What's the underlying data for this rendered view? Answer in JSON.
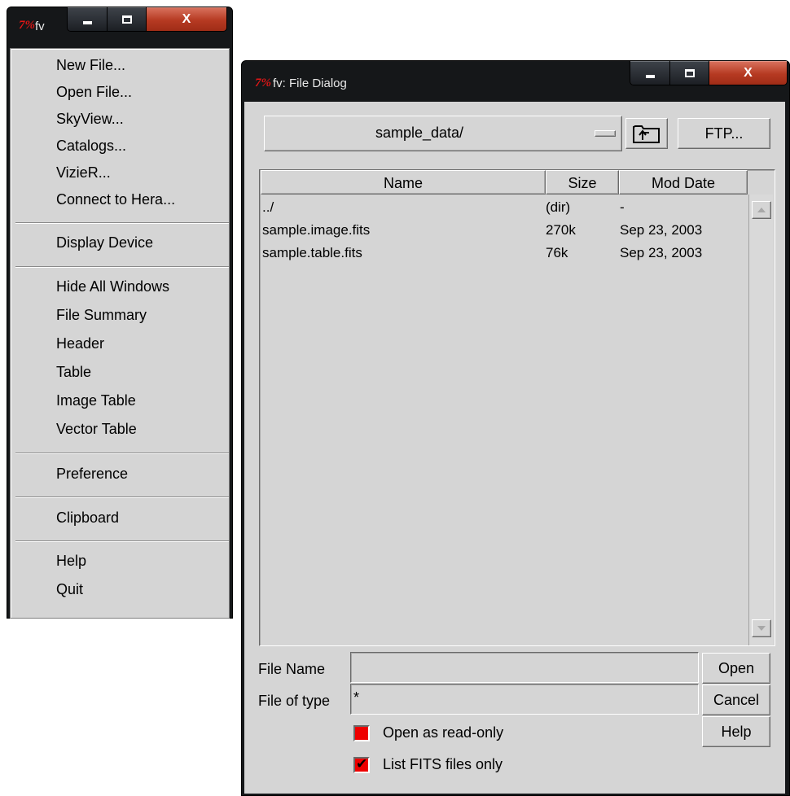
{
  "menu_window": {
    "title": "fv",
    "items": [
      "New File...",
      "Open File...",
      "SkyView...",
      "Catalogs...",
      "VizieR...",
      "Connect to Hera...",
      "Display Device",
      "Hide All Windows",
      "File Summary",
      "Header",
      "Table",
      "Image Table",
      "Vector Table",
      "Preference",
      "Clipboard",
      "Help",
      "Quit"
    ]
  },
  "dialog": {
    "title": "fv: File Dialog",
    "directory": "sample_data/",
    "ftp_label": "FTP...",
    "columns": [
      "Name",
      "Size",
      "Mod Date"
    ],
    "files": [
      {
        "name": "../",
        "size": "(dir)",
        "date": "-"
      },
      {
        "name": "sample.image.fits",
        "size": "270k",
        "date": "Sep 23, 2003"
      },
      {
        "name": "sample.table.fits",
        "size": "76k",
        "date": "Sep 23, 2003"
      }
    ],
    "file_name_label": "File Name",
    "file_name_value": "",
    "file_type_label": "File of type",
    "file_type_value": "*",
    "open_label": "Open",
    "cancel_label": "Cancel",
    "help_label": "Help",
    "readonly_label": "Open as read-only",
    "readonly_checked": false,
    "fits_only_label": "List FITS files only",
    "fits_only_checked": true
  },
  "colors": {
    "titlebar": "#151719",
    "panel": "#d5d5d5",
    "close_button": "#c0452b",
    "checkbox_fill": "#ee0000",
    "tk_logo": "#e21616"
  },
  "icons": {
    "tk_logo": "7%",
    "close": "X"
  }
}
